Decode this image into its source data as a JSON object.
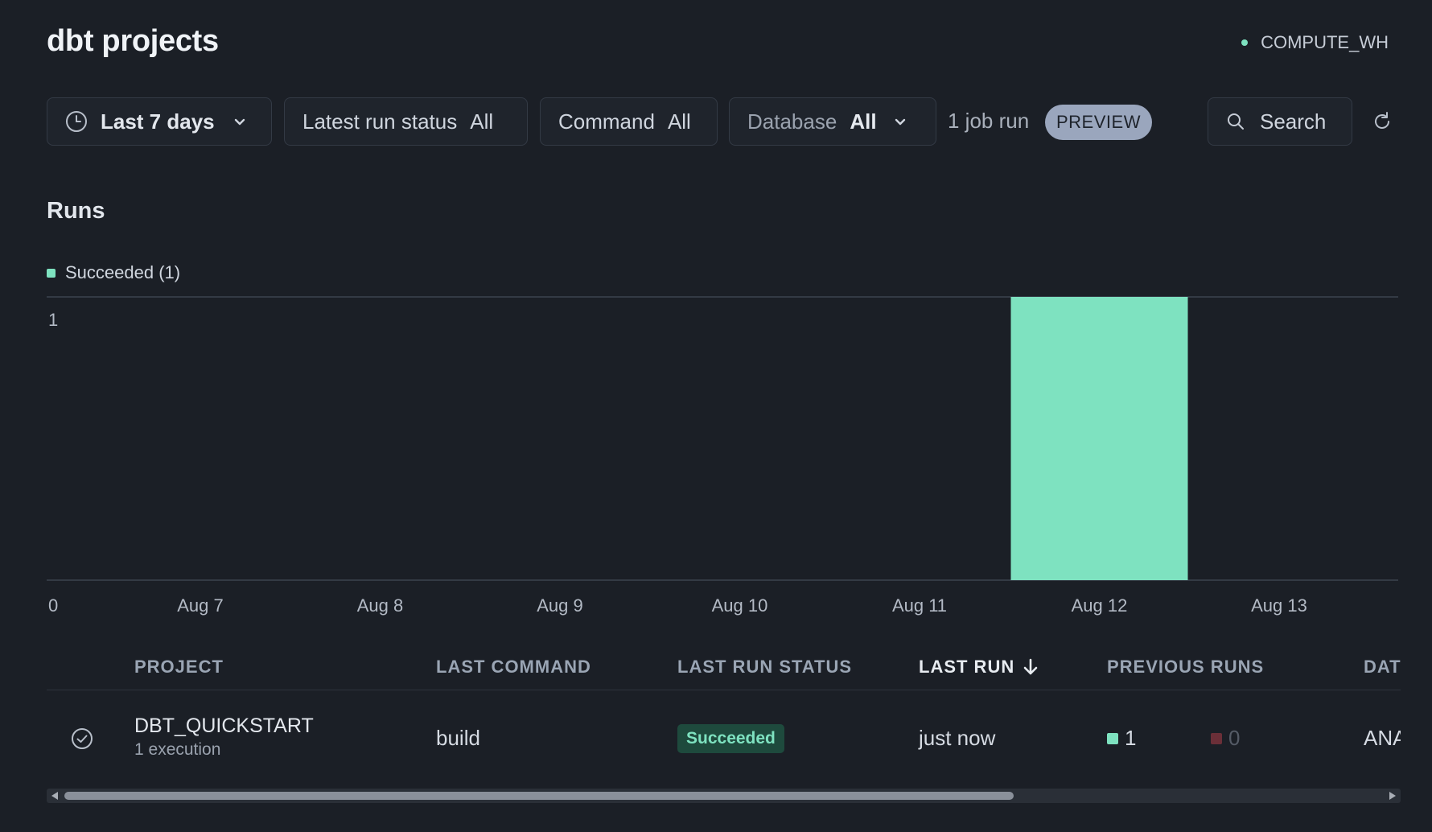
{
  "header": {
    "title": "dbt projects",
    "warehouse": "COMPUTE_WH"
  },
  "filters": {
    "time_range": "Last 7 days",
    "latest_run_status": {
      "label": "Latest run status",
      "value": "All"
    },
    "command": {
      "label": "Command",
      "value": "All"
    },
    "database": {
      "label": "Database",
      "value": "All"
    },
    "job_run_count": "1 job run",
    "preview_badge": "PREVIEW",
    "search_label": "Search"
  },
  "runs": {
    "title": "Runs",
    "legend": "Succeeded (1)"
  },
  "chart_data": {
    "type": "bar",
    "categories": [
      "Aug 7",
      "Aug 8",
      "Aug 9",
      "Aug 10",
      "Aug 11",
      "Aug 12",
      "Aug 13"
    ],
    "series": [
      {
        "name": "Succeeded",
        "values": [
          0,
          0,
          0,
          0,
          0,
          1,
          0
        ],
        "color": "#7ee2c0"
      }
    ],
    "ylim": [
      0,
      1
    ],
    "yticks": [
      "0",
      "1"
    ],
    "grid": true,
    "legend_position": "top-left"
  },
  "table": {
    "headers": [
      "PROJECT",
      "LAST COMMAND",
      "LAST RUN STATUS",
      "LAST RUN",
      "PREVIOUS RUNS",
      "DAT"
    ],
    "rows": [
      {
        "project": "DBT_QUICKSTART",
        "executions": "1 execution",
        "last_command": "build",
        "status": "Succeeded",
        "last_run": "just now",
        "prev_success": "1",
        "prev_failed": "0",
        "database": "ANA"
      }
    ]
  },
  "colors": {
    "background": "#1b1f26",
    "success": "#7ee2c0",
    "failed": "#6b2f38",
    "preview_badge": "#9aa6bd"
  }
}
